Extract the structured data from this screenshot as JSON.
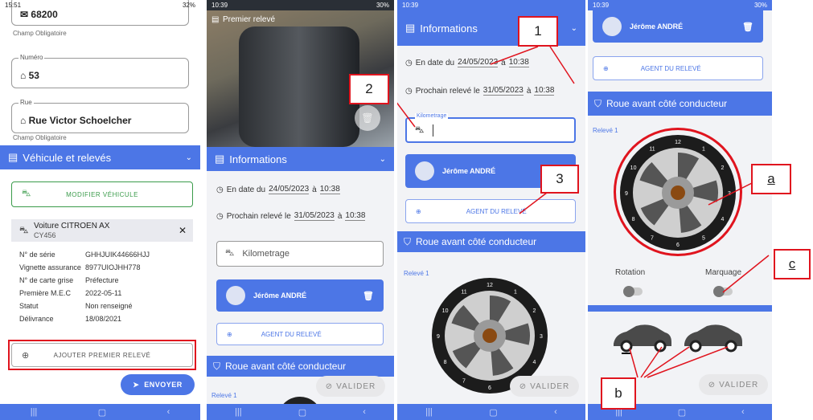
{
  "p1": {
    "time": "15:51",
    "status": "32%",
    "postal_value": "68200",
    "postal_hint": "Champ Obligatoire",
    "numero_label": "Numéro",
    "numero_value": "53",
    "rue_label": "Rue",
    "rue_value": "Rue Victor Schoelcher",
    "rue_hint": "Champ Obligatoire",
    "section_title": "Véhicule et relevés",
    "modify_btn": "MODIFIER VÉHICULE",
    "car_name": "Voiture CITROEN AX",
    "car_plate": "CY456",
    "details": [
      {
        "k": "N° de série",
        "v": "GHHJUIK44666HJJ"
      },
      {
        "k": "Vignette assurance",
        "v": "8977UIOJHH778"
      },
      {
        "k": "N° de carte grise",
        "v": "Préfecture"
      },
      {
        "k": "Première M.E.C",
        "v": "2022-05-11"
      },
      {
        "k": "Statut",
        "v": "Non renseigné"
      },
      {
        "k": "Délivrance",
        "v": "18/08/2021"
      }
    ],
    "add_btn": "AJOUTER PREMIER RELEVÉ",
    "send_btn": "ENVOYER"
  },
  "p2": {
    "time": "10:39",
    "status": "30%",
    "photo_title": "Premier relevé",
    "info_title": "Informations",
    "date_label": "En date du",
    "date": "24/05/2023",
    "a": "à",
    "date_time": "10:38",
    "next_label": "Prochain relevé le",
    "next_date": "31/05/2023",
    "next_time": "10:38",
    "km_placeholder": "Kilometrage",
    "agent_name": "Jérôme ANDRÉ",
    "agent_btn": "AGENT DU RELEVÉ",
    "wheel_title": "Roue avant côté conducteur",
    "releve": "Relevé 1",
    "valider": "VALIDER"
  },
  "p3": {
    "time": "10:39",
    "info_title": "Informations",
    "date_label": "En date du",
    "date": "24/05/2023",
    "a": "à",
    "date_time": "10:38",
    "next_label": "Prochain relevé le",
    "next_date": "31/05/2023",
    "next_time": "10:38",
    "km_label": "Kilometrage",
    "agent_name": "Jérôme ANDRÉ",
    "agent_btn": "AGENT DU RELEVÉ",
    "wheel_title": "Roue avant côté conducteur",
    "releve": "Relevé 1",
    "valider": "VALIDER",
    "callout_1": "1",
    "callout_2": "2",
    "callout_3": "3"
  },
  "p4": {
    "time": "10:39",
    "status": "30%",
    "agent_name": "Jérôme ANDRÉ",
    "agent_btn": "AGENT DU RELEVÉ",
    "wheel_title": "Roue avant côté conducteur",
    "releve": "Relevé 1",
    "rotation": "Rotation",
    "marquage": "Marquage",
    "valider": "VALIDER",
    "callout_a": "a",
    "callout_b": "b",
    "callout_c": "c"
  },
  "wheel_numbers": [
    "12",
    "1",
    "2",
    "3",
    "4",
    "5",
    "6",
    "7",
    "8",
    "9",
    "10",
    "11"
  ],
  "colors": {
    "primary": "#4c76e6",
    "callout": "#e0141e",
    "modify_green": "#3a9b4a"
  }
}
